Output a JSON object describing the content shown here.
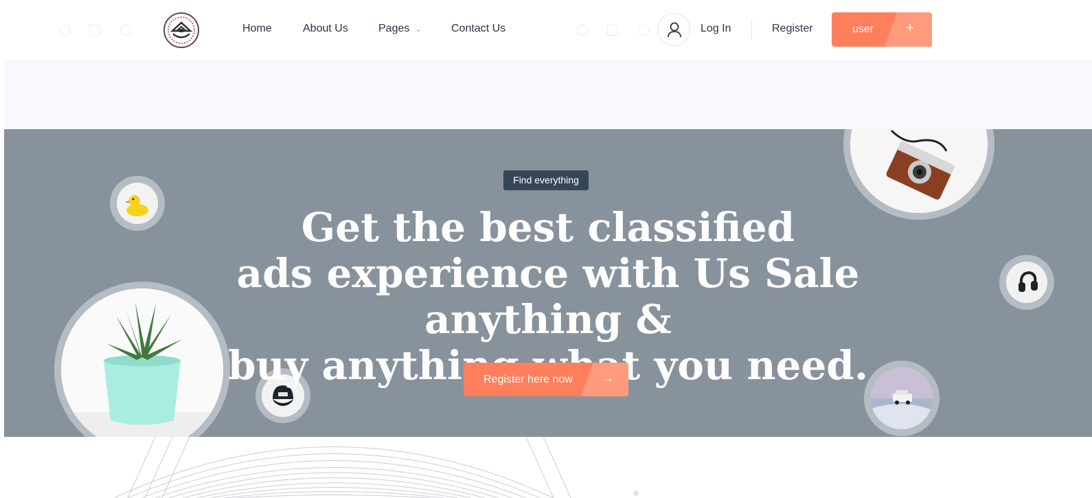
{
  "header": {
    "nav": [
      {
        "label": "Home"
      },
      {
        "label": "About Us"
      },
      {
        "label": "Pages",
        "has_dropdown": true
      },
      {
        "label": "Contact Us"
      }
    ],
    "login_label": "Log In",
    "register_label": "Register",
    "user_button": {
      "label": "user",
      "icon": "+"
    }
  },
  "hero": {
    "badge": "Find everything",
    "headline": [
      "Get the best classified",
      "ads experience with Us Sale anything &",
      "buy anything what you need."
    ],
    "cta": {
      "label": "Register here now",
      "icon": "→"
    }
  },
  "colors": {
    "accent": "#ff7f5c",
    "accent_light": "#ff9a7d",
    "hero_bg": "#87929c",
    "badge_bg": "#364656"
  },
  "icons": [
    "logo-icon",
    "user-icon",
    "plus-icon",
    "arrow-right-icon",
    "chevron-down-icon",
    "rubber-duck-image",
    "camera-image",
    "plant-image",
    "cap-image",
    "headphones-image",
    "car-image"
  ]
}
